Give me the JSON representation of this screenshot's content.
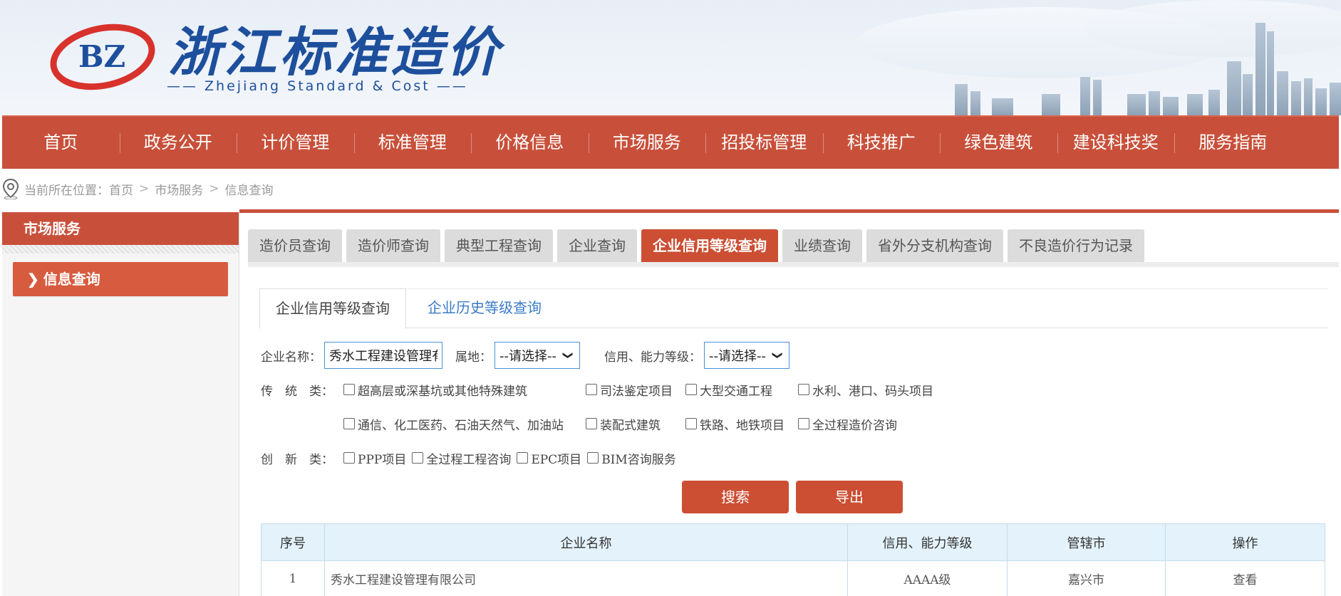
{
  "header": {
    "logo_text": "BZ",
    "title": "浙江标准造价",
    "subtitle": "—— Zhejiang Standard & Cost ——"
  },
  "nav": {
    "items": [
      "首页",
      "政务公开",
      "计价管理",
      "标准管理",
      "价格信息",
      "市场服务",
      "招投标管理",
      "科技推广",
      "绿色建筑",
      "建设科技奖",
      "服务指南"
    ]
  },
  "breadcrumb": {
    "prefix": "当前所在位置：",
    "items": [
      "首页",
      "市场服务",
      "信息查询"
    ],
    "separator": ">"
  },
  "sidebar": {
    "title": "市场服务",
    "active_item": "信息查询",
    "active_item_icon": "chevron-right-icon"
  },
  "tabs": {
    "items": [
      "造价员查询",
      "造价师查询",
      "典型工程查询",
      "企业查询",
      "企业信用等级查询",
      "业绩查询",
      "省外分支机构查询",
      "不良造价行为记录"
    ],
    "active_index": 4
  },
  "subtabs": {
    "active": "企业信用等级查询",
    "inactive": "企业历史等级查询"
  },
  "form": {
    "company_label": "企业名称：",
    "company_value": "秀水工程建设管理有",
    "region_label": "属地：",
    "region_value": "--请选择--",
    "grade_label": "信用、能力等级：",
    "grade_value": "--请选择--",
    "traditional_label": "传　统　类：",
    "traditional_options": [
      "超高层或深基坑或其他特殊建筑",
      "司法鉴定项目",
      "大型交通工程",
      "水利、港口、码头项目",
      "通信、化工医药、石油天然气、加油站",
      "装配式建筑",
      "铁路、地铁项目",
      "全过程造价咨询"
    ],
    "innovation_label": "创　新　类：",
    "innovation_options": [
      "PPP项目",
      "全过程工程咨询",
      "EPC项目",
      "BIM咨询服务"
    ],
    "search_button": "搜索",
    "export_button": "导出"
  },
  "table": {
    "headers": [
      "序号",
      "企业名称",
      "信用、能力等级",
      "管辖市",
      "操作"
    ],
    "rows": [
      {
        "index": "1",
        "name": "秀水工程建设管理有限公司",
        "grade": "AAAA级",
        "city": "嘉兴市",
        "action": "查看"
      }
    ]
  },
  "colors": {
    "brand_red": "#c8503a",
    "active_tab": "#cc4e33",
    "link_blue": "#3a7bc8",
    "title_blue": "#1d4f9c",
    "table_header_bg": "#e3f2fb"
  }
}
